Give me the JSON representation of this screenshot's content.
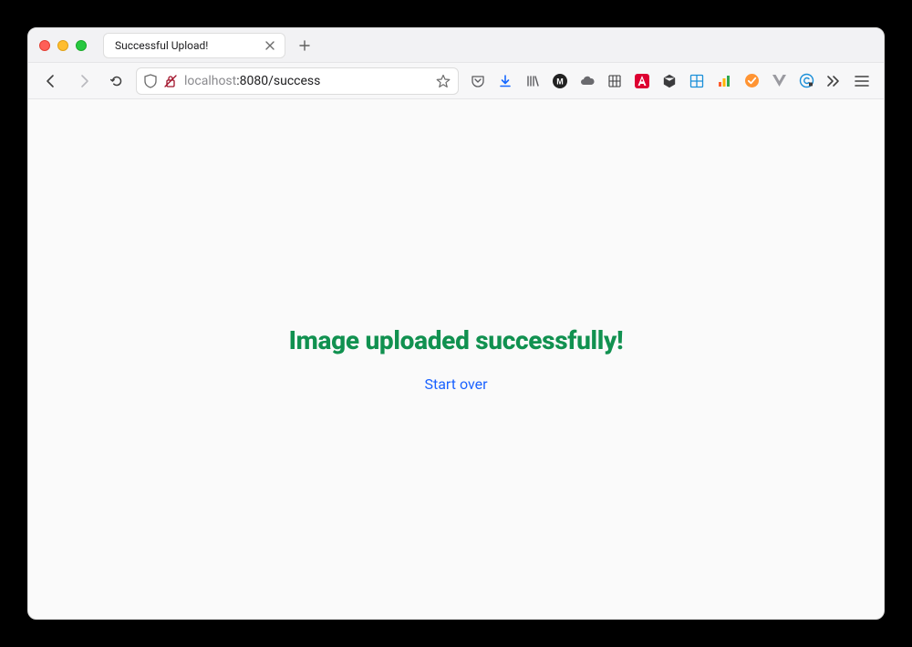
{
  "window": {
    "tab_title": "Successful Upload!"
  },
  "urlbar": {
    "host_faded": "localhost",
    "host_rest": ":8080/success"
  },
  "page": {
    "heading": "Image uploaded successfully!",
    "start_over_label": "Start over"
  }
}
